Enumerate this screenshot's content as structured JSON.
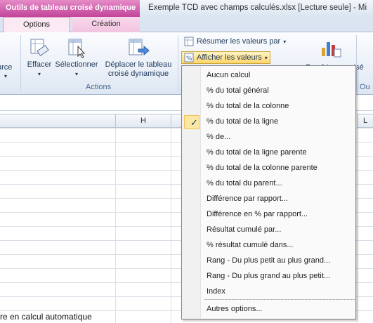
{
  "titlebar": {
    "contextual": "Outils de tableau croisé dynamique",
    "title": "Exemple TCD avec champs calculés.xlsx  [Lecture seule]  -  Mi"
  },
  "tabs": {
    "options": "Options",
    "creation": "Création"
  },
  "ribbon": {
    "source_label": "urce",
    "effacer": "Effacer",
    "selectionner": "Sélectionner",
    "deplacer_line1": "Déplacer le tableau",
    "deplacer_line2": "croisé dynamique",
    "actions_group": "Actions",
    "resumer": "Résumer les valeurs par",
    "afficher": "Afficher les valeurs",
    "graphique": "Graphique croisé",
    "ou_label": "Ou"
  },
  "grid": {
    "col_h": "H",
    "col_l": "L",
    "bottom_text": "re en calcul automatique"
  },
  "menu": {
    "items": [
      {
        "label": "Aucun calcul",
        "checked": false
      },
      {
        "label": "% du total général",
        "checked": false
      },
      {
        "label": "% du total de la colonne",
        "checked": false
      },
      {
        "label": "% du total de la ligne",
        "checked": true
      },
      {
        "label": "% de...",
        "checked": false
      },
      {
        "label": "% du total de la ligne parente",
        "checked": false
      },
      {
        "label": "% du total de la colonne parente",
        "checked": false
      },
      {
        "label": "% du total du parent...",
        "checked": false
      },
      {
        "label": "Différence par rapport...",
        "checked": false
      },
      {
        "label": "Différence en % par rapport...",
        "checked": false
      },
      {
        "label": "Résultat cumulé par...",
        "checked": false
      },
      {
        "label": "% résultat cumulé dans...",
        "checked": false
      },
      {
        "label": "Rang - Du plus petit au plus grand...",
        "checked": false
      },
      {
        "label": "Rang - Du plus grand au plus petit...",
        "checked": false
      },
      {
        "label": "Index",
        "checked": false
      }
    ],
    "more": "Autres options...",
    "check_glyph": "✓"
  },
  "colors": {
    "contextual": "#c2449a",
    "highlight": "#fce7a4",
    "ribbon_text": "#1e395b"
  }
}
